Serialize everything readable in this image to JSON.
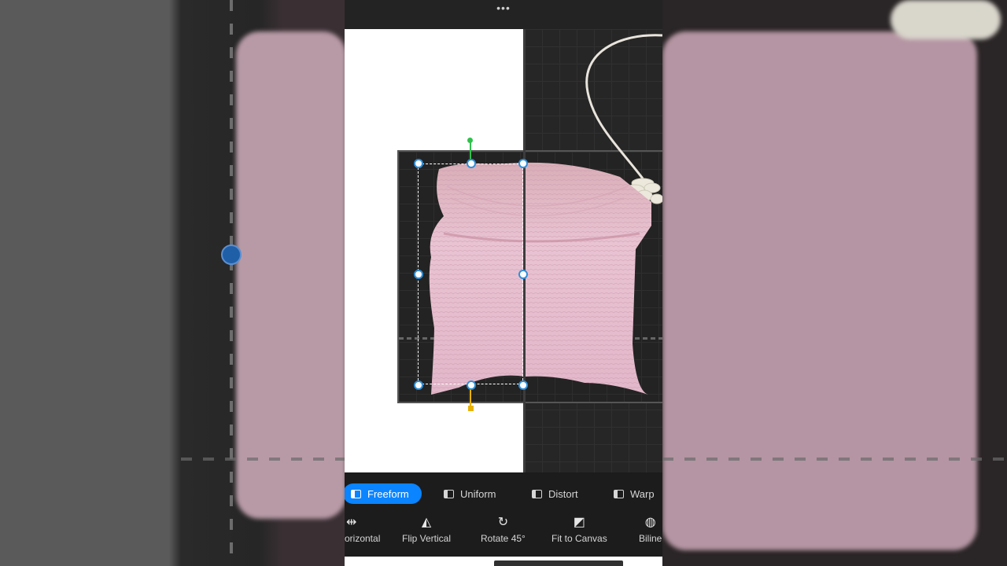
{
  "top_bar": {
    "more_glyph": "•••"
  },
  "modes": [
    {
      "label": "Freeform",
      "icon": "freeform-icon",
      "active": true
    },
    {
      "label": "Uniform",
      "icon": "uniform-icon",
      "active": false
    },
    {
      "label": "Distort",
      "icon": "distort-icon",
      "active": false
    },
    {
      "label": "Warp",
      "icon": "warp-icon",
      "active": false
    }
  ],
  "tools": [
    {
      "label": "orizontal",
      "icon": "flip-horizontal-icon",
      "glyph": "⇹"
    },
    {
      "label": "Flip Vertical",
      "icon": "flip-vertical-icon",
      "glyph": "◭"
    },
    {
      "label": "Rotate 45°",
      "icon": "rotate-icon",
      "glyph": "↻"
    },
    {
      "label": "Fit to Canvas",
      "icon": "fit-to-canvas-icon",
      "glyph": "◩"
    },
    {
      "label": "Biline",
      "icon": "bilinear-icon",
      "glyph": "◍"
    }
  ],
  "colors": {
    "accent": "#0a84ff",
    "rotation_handle": "#2ec24a",
    "anchor_handle": "#e8b200",
    "selection_handle": "#2f8fd8",
    "cloth_pink": "#e7b9cb"
  }
}
